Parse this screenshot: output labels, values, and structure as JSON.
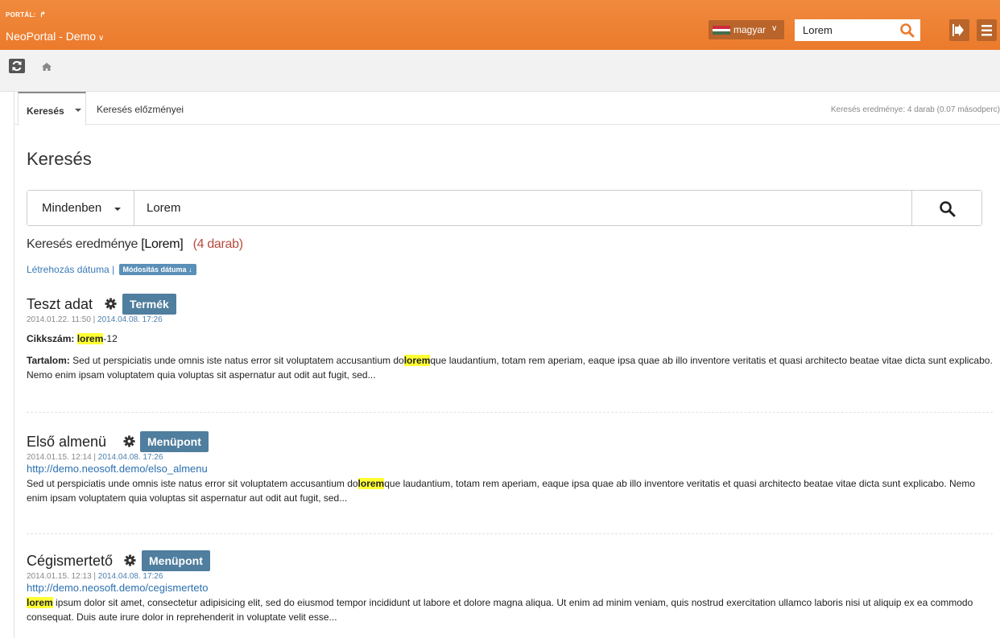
{
  "topbar": {
    "portal_label": "PORTÁL:",
    "portal_icon": "share-icon",
    "portal_name": "NeoPortal - Demo",
    "language": "magyar",
    "search_value": "Lorem",
    "colors": {
      "bar": "#ec7a2c",
      "button": "#b9642a"
    }
  },
  "toolbar": {
    "refresh_icon": "refresh-icon",
    "home_icon": "home-icon"
  },
  "tabs": {
    "active": "Keresés",
    "history": "Keresés előzményei",
    "result_summary": "Keresés eredménye: 4 darab (0.07 másodperc)"
  },
  "page_title": "Keresés",
  "search": {
    "scope": "Mindenben",
    "query": "Lorem"
  },
  "results_header": {
    "label": "Keresés eredménye",
    "term": "[Lorem]",
    "count": "(4 darab)"
  },
  "sort": {
    "created": "Létrehozás dátuma",
    "separator": "|",
    "modified": "Módosítás dátuma"
  },
  "results": [
    {
      "title": "Teszt adat",
      "type": "Termék",
      "created": "2014.01.22. 11:50",
      "modified": "2014.04.08. 17:26",
      "field1_label": "Cikkszám:",
      "field1_hl": "lorem",
      "field1_rest": "-12",
      "content_label": "Tartalom:",
      "text_pre": "Sed ut perspiciatis unde omnis iste natus error sit voluptatem accusantium do",
      "text_hl": "lorem",
      "text_post": "que laudantium, totam rem aperiam, eaque ipsa quae ab illo inventore veritatis et quasi architecto beatae vitae dicta sunt explicabo. Nemo enim ipsam voluptatem quia voluptas sit aspernatur aut odit aut fugit, sed..."
    },
    {
      "title": "Első almenü",
      "type": "Menüpont",
      "created": "2014.01.15. 12:14",
      "modified": "2014.04.08. 17:26",
      "url": "http://demo.neosoft.demo/elso_almenu",
      "text_pre": "Sed ut perspiciatis unde omnis iste natus error sit voluptatem accusantium do",
      "text_hl": "lorem",
      "text_post": "que laudantium, totam rem aperiam, eaque ipsa quae ab illo inventore veritatis et quasi architecto beatae vitae dicta sunt explicabo. Nemo enim ipsam voluptatem quia voluptas sit aspernatur aut odit aut fugit, sed..."
    },
    {
      "title": "Cégismertető",
      "type": "Menüpont",
      "created": "2014.01.15. 12:13",
      "modified": "2014.04.08. 17:26",
      "url": "http://demo.neosoft.demo/cegismerteto",
      "text_hl": "lorem",
      "text_post": " ipsum dolor sit amet, consectetur adipisicing elit, sed do eiusmod tempor incididunt ut labore et dolore magna aliqua. Ut enim ad minim veniam, quis nostrud exercitation ullamco laboris nisi ut aliquip ex ea commodo consequat. Duis aute irure dolor in reprehenderit in voluptate velit esse..."
    }
  ]
}
